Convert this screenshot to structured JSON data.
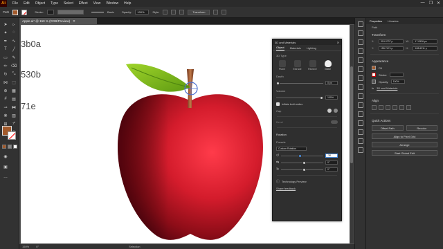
{
  "menu": {
    "logo": "Ai",
    "items": [
      "File",
      "Edit",
      "Object",
      "Type",
      "Select",
      "Effect",
      "View",
      "Window",
      "Help"
    ],
    "window_controls": [
      "—",
      "❐",
      "✕"
    ]
  },
  "control_bar": {
    "selection_label": "Path",
    "stroke_label": "Stroke:",
    "brush_label": "Basic",
    "opacity_label": "Opacity:",
    "opacity_value": "100%",
    "style_label": "Style:",
    "transform_label": "Transform"
  },
  "document_tab": {
    "title": "Apple.ai* @ 150 % (RGB/Preview)",
    "close": "✕"
  },
  "artboard": {
    "texts": [
      "3b0a",
      "530b",
      "71e"
    ]
  },
  "status_bar": {
    "zoom": "150%",
    "angle": "0°",
    "mode": "Selection"
  },
  "panel_3d": {
    "title": "3D and Materials",
    "tabs": [
      "Object",
      "Materials",
      "Lighting"
    ],
    "section_3d_type": "3D Type",
    "types": [
      "Plane",
      "Extrude",
      "Revolve",
      "Inflate"
    ],
    "depth_label": "Depth",
    "depth_value": "0 px",
    "volume_label": "Volume",
    "volume_value": "100%",
    "inflate_both_label": "Inflate both sides",
    "cap_label": "Cap",
    "bevel_label": "Bevel",
    "rotation_label": "Rotation",
    "presets_label": "Presets",
    "preset_value": "Custom Rotation",
    "rot_x_value": "-30",
    "rot_y_value": "0°",
    "rot_z_value": "0°",
    "tech_preview": "Technology Preview",
    "share_feedback": "Share feedback"
  },
  "properties": {
    "tabs": [
      "Properties",
      "Libraries"
    ],
    "path_label": "Path",
    "transform_label": "Transform",
    "x_label": "X:",
    "x_value": "319.0737 p",
    "w_label": "W:",
    "w_value": "17.0526 px",
    "y_label": "Y:",
    "y_value": "155.7474 p",
    "h_label": "H:",
    "h_value": "108.6211 p",
    "appearance_label": "Appearance",
    "fill_label": "Fill",
    "stroke_label": "Stroke",
    "opacity_label": "Opacity",
    "opacity_value": "100%",
    "effect_label": "3D and Materials",
    "align_label": "Align",
    "quick_actions_label": "Quick Actions",
    "offset_path": "Offset Path",
    "recolor": "Recolor",
    "align_pixel": "Align to Pixel Grid",
    "arrange": "Arrange",
    "start_global_edit": "Start Global Edit"
  },
  "colors": {
    "fill": "#a35a2b",
    "apple_red": "#d4232f",
    "leaf_green": "#7ab51d",
    "stem": "#8b4a2b"
  }
}
